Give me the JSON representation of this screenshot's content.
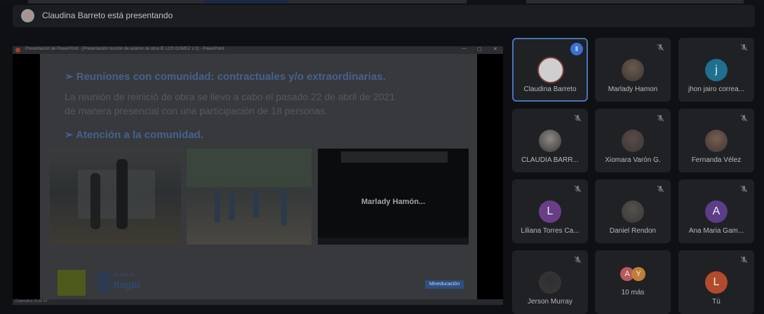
{
  "banner": {
    "text": "Claudina Barreto está presentando"
  },
  "powerpoint": {
    "window_title": "Presentación de PowerPoint - [Presentación reunión de avance de obra IE LOS GOMEZ V.2] - PowerPoint",
    "controls": [
      "—",
      "▢",
      "✕"
    ],
    "status": "Diapositiva 16 de 34"
  },
  "slide": {
    "bullet1": "➢ Reuniones con comunidad: contractuales y/o extraordinarias.",
    "body_line1": "La reunión de reinició de obra se llevo a cabo el pasado 22 de abril de 2021",
    "body_line2": "de manera presencial con una participación de 18 personas.",
    "bullet2": "➢ Atención a la comunidad.",
    "photo3_name": "Marlady  Hamón...",
    "logo_b_small": "Alcaldía de",
    "logo_b_text": "Itagüí",
    "mineducacion": "Mineducación"
  },
  "participants": [
    {
      "name": "Claudina Barreto",
      "avatar": "logo",
      "speaking": true
    },
    {
      "name": "Marlady Hamon",
      "avatar": "photo",
      "color": "#6b5a4e"
    },
    {
      "name": "jhon jairo correa...",
      "avatar": "letter",
      "letter": "j",
      "color": "#1f6f8f"
    },
    {
      "name": "CLAUDIA BARR...",
      "avatar": "photo",
      "color": "#8d8a86"
    },
    {
      "name": "Xiomara Varón G.",
      "avatar": "photo",
      "color": "#5a4c46"
    },
    {
      "name": "Fernanda Vélez",
      "avatar": "photo",
      "color": "#7a5d4f"
    },
    {
      "name": "Liliana Torres Ca...",
      "avatar": "letter",
      "letter": "L",
      "color": "#6a3e86"
    },
    {
      "name": "Daniel Rendon",
      "avatar": "photo",
      "color": "#55514d"
    },
    {
      "name": "Ana Maria Gam...",
      "avatar": "letter",
      "letter": "A",
      "color": "#5b3d88"
    },
    {
      "name": "Jerson Murray",
      "avatar": "photo",
      "color": "#2e2f33"
    },
    {
      "name": "10 más",
      "avatar": "stack",
      "letters": [
        "A",
        "Y"
      ]
    },
    {
      "name": "Tú",
      "avatar": "letter",
      "letter": "L",
      "color": "#b24a2c"
    }
  ],
  "icons": {
    "mute": "mic-off-icon",
    "speaking": "audio-bars-icon"
  }
}
